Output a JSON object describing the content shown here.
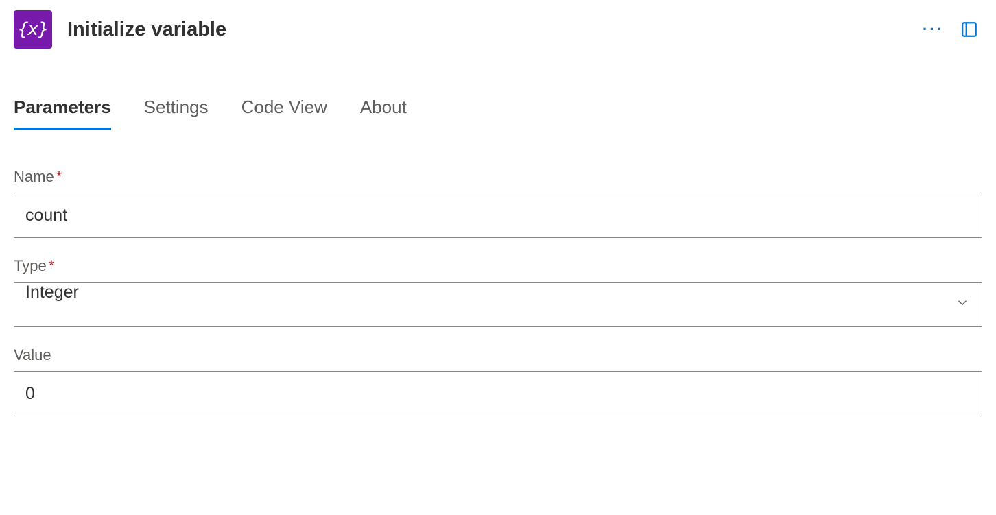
{
  "header": {
    "icon_glyph": "{x}",
    "title": "Initialize variable"
  },
  "tabs": {
    "parameters": "Parameters",
    "settings": "Settings",
    "codeview": "Code View",
    "about": "About"
  },
  "form": {
    "name": {
      "label": "Name",
      "value": "count"
    },
    "type": {
      "label": "Type",
      "value": "Integer"
    },
    "value": {
      "label": "Value",
      "value": "0"
    }
  }
}
